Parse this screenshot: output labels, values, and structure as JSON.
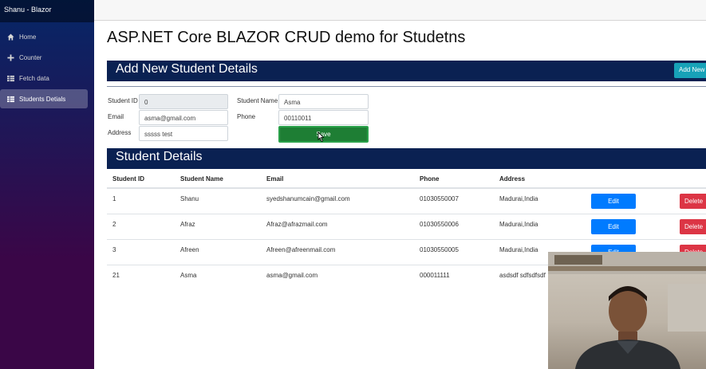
{
  "app": {
    "brand": "Shanu - Blazor"
  },
  "sidebar": {
    "items": [
      {
        "label": "Home",
        "icon": "home-icon",
        "active": false
      },
      {
        "label": "Counter",
        "icon": "plus-icon",
        "active": false
      },
      {
        "label": "Fetch data",
        "icon": "list-icon",
        "active": false
      },
      {
        "label": "Students Detials",
        "icon": "list-icon",
        "active": true
      }
    ]
  },
  "page": {
    "title": "ASP.NET Core BLAZOR CRUD demo for Studetns"
  },
  "form": {
    "header": "Add New Student Details",
    "add_new_label": "Add New",
    "student_id_label": "Student ID",
    "student_id_value": "0",
    "student_name_label": "Student Name",
    "student_name_value": "Asma",
    "email_label": "Email",
    "email_value": "asma@gmail.com",
    "phone_label": "Phone",
    "phone_value": "00110011",
    "address_label": "Address",
    "address_value": "sssss test",
    "save_label": "Save"
  },
  "table": {
    "header": "Student Details",
    "columns": [
      "Student ID",
      "Student Name",
      "Email",
      "Phone",
      "Address"
    ],
    "edit_label": "Edit",
    "delete_label": "Delete",
    "rows": [
      {
        "id": "1",
        "name": "Shanu",
        "email": "syedshanumcain@gmail.com",
        "phone": "01030550007",
        "address": "Madurai,India"
      },
      {
        "id": "2",
        "name": "Afraz",
        "email": "Afraz@afrazmail.com",
        "phone": "01030550006",
        "address": "Madurai,India"
      },
      {
        "id": "3",
        "name": "Afreen",
        "email": "Afreen@afreenmail.com",
        "phone": "01030550005",
        "address": "Madurai,India"
      },
      {
        "id": "21",
        "name": "Asma",
        "email": "asma@gmail.com",
        "phone": "000011111",
        "address": "asdsdf sdfsdfsdf"
      }
    ]
  },
  "colors": {
    "band": "#0a2152",
    "save": "#1e7e34",
    "edit": "#007bff",
    "delete": "#dc3545",
    "add_new": "#17a2b8"
  }
}
